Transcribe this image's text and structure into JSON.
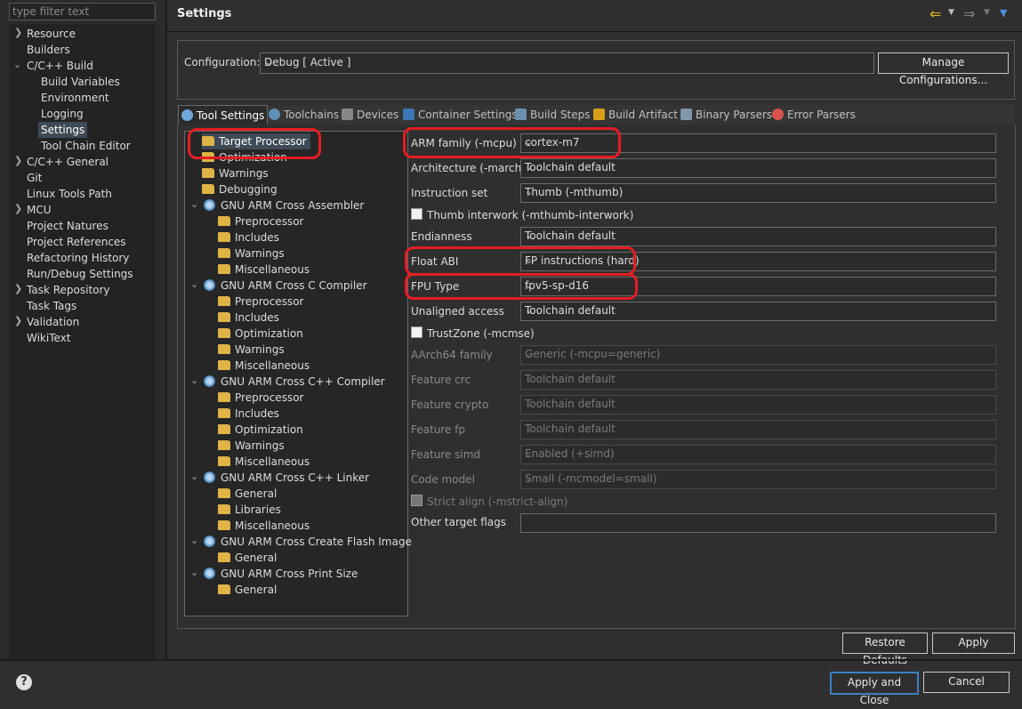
{
  "filter_placeholder": "type filter text",
  "nav": [
    {
      "label": "Resource",
      "chevron": "right"
    },
    {
      "label": "Builders",
      "chevron": ""
    },
    {
      "label": "C/C++ Build",
      "chevron": "down"
    },
    {
      "label": "Build Variables",
      "chevron": ""
    },
    {
      "label": "Environment",
      "chevron": ""
    },
    {
      "label": "Logging",
      "chevron": ""
    },
    {
      "label": "Settings",
      "chevron": "",
      "selected": true
    },
    {
      "label": "Tool Chain Editor",
      "chevron": ""
    },
    {
      "label": "C/C++ General",
      "chevron": "right"
    },
    {
      "label": "Git",
      "chevron": ""
    },
    {
      "label": "Linux Tools Path",
      "chevron": ""
    },
    {
      "label": "MCU",
      "chevron": "right"
    },
    {
      "label": "Project Natures",
      "chevron": ""
    },
    {
      "label": "Project References",
      "chevron": ""
    },
    {
      "label": "Refactoring History",
      "chevron": ""
    },
    {
      "label": "Run/Debug Settings",
      "chevron": ""
    },
    {
      "label": "Task Repository",
      "chevron": "right"
    },
    {
      "label": "Task Tags",
      "chevron": ""
    },
    {
      "label": "Validation",
      "chevron": "right"
    },
    {
      "label": "WikiText",
      "chevron": ""
    }
  ],
  "title": "Settings",
  "config": {
    "label": "Configuration:",
    "value": "Debug  [ Active ]",
    "manage": "Manage Configurations..."
  },
  "tabs": [
    "Tool Settings",
    "Toolchains",
    "Devices",
    "Container Settings",
    "Build Steps",
    "Build Artifact",
    "Binary Parsers",
    "Error Parsers"
  ],
  "tool_tree": [
    {
      "label": "Target Processor",
      "type": "folder",
      "selected": true
    },
    {
      "label": "Optimization",
      "type": "folder"
    },
    {
      "label": "Warnings",
      "type": "folder"
    },
    {
      "label": "Debugging",
      "type": "folder"
    },
    {
      "label": "GNU ARM Cross Assembler",
      "type": "tool"
    },
    {
      "label": "Preprocessor",
      "type": "folder"
    },
    {
      "label": "Includes",
      "type": "folder"
    },
    {
      "label": "Warnings",
      "type": "folder"
    },
    {
      "label": "Miscellaneous",
      "type": "folder"
    },
    {
      "label": "GNU ARM Cross C Compiler",
      "type": "tool"
    },
    {
      "label": "Preprocessor",
      "type": "folder"
    },
    {
      "label": "Includes",
      "type": "folder"
    },
    {
      "label": "Optimization",
      "type": "folder"
    },
    {
      "label": "Warnings",
      "type": "folder"
    },
    {
      "label": "Miscellaneous",
      "type": "folder"
    },
    {
      "label": "GNU ARM Cross C++ Compiler",
      "type": "tool"
    },
    {
      "label": "Preprocessor",
      "type": "folder"
    },
    {
      "label": "Includes",
      "type": "folder"
    },
    {
      "label": "Optimization",
      "type": "folder"
    },
    {
      "label": "Warnings",
      "type": "folder"
    },
    {
      "label": "Miscellaneous",
      "type": "folder"
    },
    {
      "label": "GNU ARM Cross C++ Linker",
      "type": "tool"
    },
    {
      "label": "General",
      "type": "folder"
    },
    {
      "label": "Libraries",
      "type": "folder"
    },
    {
      "label": "Miscellaneous",
      "type": "folder"
    },
    {
      "label": "GNU ARM Cross Create Flash Image",
      "type": "tool"
    },
    {
      "label": "General",
      "type": "folder"
    },
    {
      "label": "GNU ARM Cross Print Size",
      "type": "tool"
    },
    {
      "label": "General",
      "type": "folder"
    }
  ],
  "fields": [
    {
      "kind": "select",
      "label": "ARM family (-mcpu)",
      "value": "cortex-m7"
    },
    {
      "kind": "select",
      "label": "Architecture (-march)",
      "value": "Toolchain default"
    },
    {
      "kind": "select",
      "label": "Instruction set",
      "value": "Thumb (-mthumb)"
    },
    {
      "kind": "check",
      "label": "Thumb interwork (-mthumb-interwork)"
    },
    {
      "kind": "select",
      "label": "Endianness",
      "value": "Toolchain default"
    },
    {
      "kind": "select",
      "label": "Float ABI",
      "value": "FP instructions (hard)"
    },
    {
      "kind": "select",
      "label": "FPU Type",
      "value": "fpv5-sp-d16"
    },
    {
      "kind": "select",
      "label": "Unaligned access",
      "value": "Toolchain default"
    },
    {
      "kind": "check",
      "label": "TrustZone (-mcmse)"
    },
    {
      "kind": "select",
      "label": "AArch64 family",
      "value": "Generic (-mcpu=generic)",
      "disabled": true
    },
    {
      "kind": "select",
      "label": "Feature crc",
      "value": "Toolchain default",
      "disabled": true
    },
    {
      "kind": "select",
      "label": "Feature crypto",
      "value": "Toolchain default",
      "disabled": true
    },
    {
      "kind": "select",
      "label": "Feature fp",
      "value": "Toolchain default",
      "disabled": true
    },
    {
      "kind": "select",
      "label": "Feature simd",
      "value": "Enabled (+simd)",
      "disabled": true
    },
    {
      "kind": "select",
      "label": "Code model",
      "value": "Small (-mcmodel=small)",
      "disabled": true
    },
    {
      "kind": "check",
      "label": "Strict align (-mstrict-align)",
      "disabled": true
    },
    {
      "kind": "text",
      "label": "Other target flags",
      "value": ""
    }
  ],
  "buttons": {
    "restore": "Restore Defaults",
    "apply": "Apply",
    "apply_close": "Apply and Close",
    "cancel": "Cancel"
  },
  "help": "?",
  "colors": {
    "highlight": "#e51c23",
    "accent": "#3d7fc2",
    "back_arrow": "#f0c419"
  }
}
